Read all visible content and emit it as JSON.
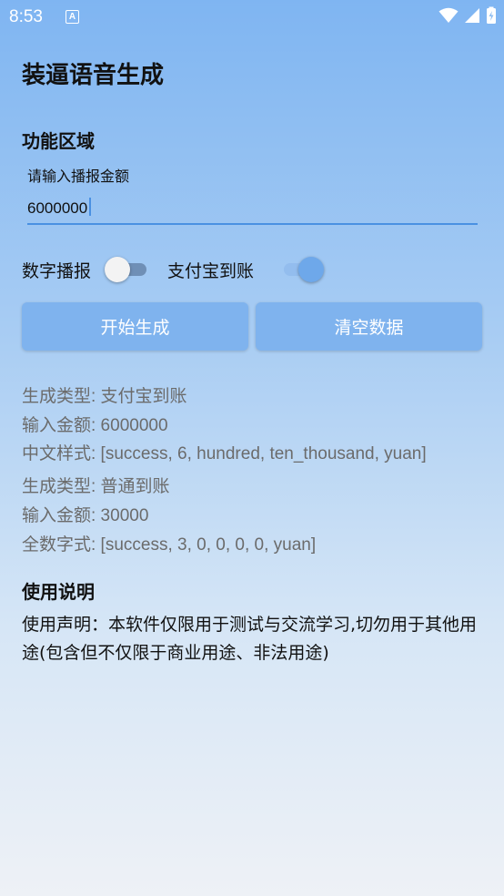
{
  "status_bar": {
    "time": "8:53",
    "notification_icon": "A"
  },
  "app": {
    "title": "装逼语音生成"
  },
  "function_section": {
    "title": "功能区域",
    "input_label": "请输入播报金额",
    "input_value": "6000000"
  },
  "toggles": [
    {
      "label": "数字播报",
      "checked": false
    },
    {
      "label": "支付宝到账",
      "checked": true
    }
  ],
  "buttons": {
    "generate": "开始生成",
    "clear": "清空数据"
  },
  "results": [
    "生成类型: 支付宝到账",
    "输入金额: 6000000",
    "中文样式: [success, 6, hundred, ten_thousand, yuan]",
    "生成类型: 普通到账",
    "输入金额: 30000",
    "全数字式: [success, 3, 0, 0, 0, 0, yuan]"
  ],
  "usage": {
    "title": "使用说明",
    "text": "使用声明：本软件仅限用于测试与交流学习,切勿用于其他用途(包含但不仅限于商业用途、非法用途)"
  },
  "colors": {
    "accent": "#4a90e2",
    "button": "#7fb3ee",
    "result_text": "#6b6b6b"
  }
}
